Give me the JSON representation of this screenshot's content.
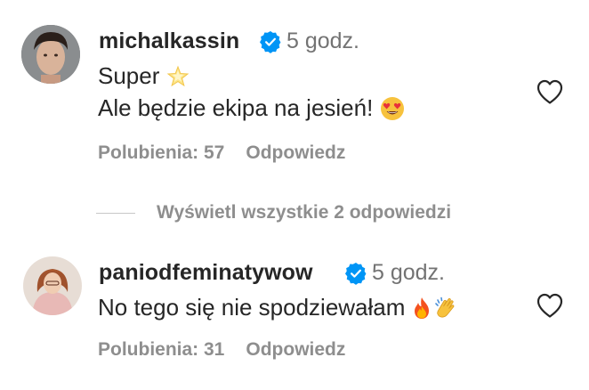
{
  "comments": [
    {
      "username": "michalkassin",
      "time": "5 godz.",
      "lines": [
        "Super",
        "Ale będzie ekipa na jesień!"
      ],
      "likes_label": "Polubienia: 57",
      "reply_label": "Odpowiedz",
      "line1_emoji": "glowing-star",
      "line2_emoji": "heart-eyes"
    },
    {
      "username": "paniodfeminatywow",
      "time": "5 godz.",
      "lines": [
        "No tego się nie spodziewałam"
      ],
      "likes_label": "Polubienia: 31",
      "reply_label": "Odpowiedz",
      "line1_emoji": "fire, clapping-hands"
    }
  ],
  "view_replies_label": "Wyświetl wszystkie 2 odpowiedzi",
  "colors": {
    "text": "#262626",
    "muted": "#8e8e8e",
    "verified": "#0095f6"
  }
}
